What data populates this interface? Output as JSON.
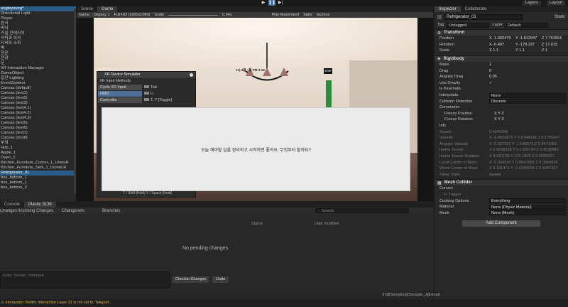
{
  "toolbar": {
    "play": "▶",
    "pause": "❚❚",
    "step": "▶|",
    "layers_label": "Layers",
    "layout_label": "Layout"
  },
  "hierarchy": {
    "items": [
      {
        "label": "angleyoung*",
        "selected": true
      },
      {
        "label": "Directional Light"
      },
      {
        "label": "Player"
      },
      {
        "label": "음식"
      },
      {
        "label": "바닥"
      },
      {
        "label": "거실 인테리어"
      },
      {
        "label": "식탁과 의자"
      },
      {
        "label": "티비와 소파"
      },
      {
        "label": "벽"
      },
      {
        "label": "창문"
      },
      {
        "label": "천장"
      },
      {
        "label": "문"
      },
      {
        "label": "XR Interaction Manager"
      },
      {
        "label": "GameObject"
      },
      {
        "label": "집안 Lighting"
      },
      {
        "label": "EventSystem"
      },
      {
        "label": "Canvas (default)"
      },
      {
        "label": "Canvas (text1)"
      },
      {
        "label": "Canvas (text2)"
      },
      {
        "label": "Canvas (text3)"
      },
      {
        "label": "Canvas (text4.1)"
      },
      {
        "label": "Canvas (text4.2)"
      },
      {
        "label": "Canvas (text4.3)"
      },
      {
        "label": "Canvas (text5)"
      },
      {
        "label": "Canvas (text6)"
      },
      {
        "label": "Canvas (text7)"
      },
      {
        "label": "Canvas (text8)"
      },
      {
        "label": "부엌"
      },
      {
        "label": "Hob_1"
      },
      {
        "label": "Apple_1"
      },
      {
        "label": "Oven_2"
      },
      {
        "label": "Kitchen_Furniture_Corner_1_UnionR"
      },
      {
        "label": "Kitchen_Furniture_Sink_1_UnionLR"
      },
      {
        "label": "Refrigerator_01",
        "highlight": true
      },
      {
        "label": "box_bottom_1"
      },
      {
        "label": "box_bottom_1"
      },
      {
        "label": "box_bottom_3"
      }
    ]
  },
  "game_view": {
    "tab_scene": "Scene",
    "tab_game": "Game",
    "mode": "Game",
    "display": "Display 1",
    "resolution": "Full HD (1920x1080)",
    "scale_label": "Scale",
    "scale_value": "0.54x",
    "play_maximized": "Play Maximized",
    "stats": "Stats",
    "gizmos": "Gizmos",
    "stop_sign": "STOP",
    "scene_text": "ex) 4월 ○일 PM 3:15",
    "dialog_text": "오늘 해야할 일을 정리하고 시작하면 좋아요. 무엇부터 할까요?"
  },
  "xr_simulator": {
    "title": "XR Device Simulator",
    "subtitle": "XR Input Methods",
    "rows": [
      {
        "button": "Cycle XR Input",
        "key": "Tab",
        "active": false
      },
      {
        "button": "HMD",
        "key": "U",
        "active": true
      },
      {
        "button": "Controller",
        "key": "T, Y [Toggle]",
        "active": false
      }
    ],
    "footer": "T / Shift [Hold]   Y / Space [Hold]"
  },
  "inspector": {
    "tab_inspector": "Inspector",
    "tab_collaborate": "Collaborate",
    "object_name": "Refrigerator_01",
    "static_label": "Static",
    "tag_label": "Tag",
    "tag_value": "Untagged",
    "layer_label": "Layer",
    "layer_value": "Default",
    "transform": {
      "title": "Transform",
      "position": {
        "label": "Position",
        "x": "X -1.602479",
        "y": "Y -1.812947",
        "z": "Z 7.761551"
      },
      "rotation": {
        "label": "Rotation",
        "x": "X -0.497",
        "y": "Y -178.337",
        "z": "Z 17.015"
      },
      "scale": {
        "label": "Scale",
        "x": "X 1.1",
        "y": "Y 1.1",
        "z": "Z 1"
      }
    },
    "rigidbody": {
      "title": "Rigidbody",
      "mass": {
        "label": "Mass",
        "value": "1"
      },
      "drag": {
        "label": "Drag",
        "value": "0"
      },
      "angular_drag": {
        "label": "Angular Drag",
        "value": "0.05"
      },
      "use_gravity": {
        "label": "Use Gravity",
        "value": "✓"
      },
      "is_kinematic": {
        "label": "Is Kinematic",
        "value": ""
      },
      "interpolate": {
        "label": "Interpolate",
        "value": "None"
      },
      "collision_detection": {
        "label": "Collision Detection",
        "value": "Discrete"
      },
      "constraints": "Constraints",
      "freeze_position": {
        "label": "Freeze Position",
        "value": "X  Y  Z"
      },
      "freeze_rotation": {
        "label": "Freeze Rotation",
        "value": "X  Y  Z"
      },
      "info": "Info",
      "speed": {
        "label": "Speed",
        "value": "0.4944396"
      },
      "velocity": {
        "label": "Velocity",
        "value": "X -0.4603875  Y 0.0344318  Z 0.1755247"
      },
      "angular_velocity": {
        "label": "Angular Velocity",
        "value": "X -0.237302  Y -1.635573  Z 0.8471055"
      },
      "inertia_tensor": {
        "label": "Inertia Tensor",
        "value": "X 0.4298398  Y 0.1300104  Z 0.3536889"
      },
      "inertia_tensor_rotation": {
        "label": "Inertia Tensor Rotation",
        "value": "X 4.510139  Y 315.1805  Z 0.0286557"
      },
      "local_center": {
        "label": "Local Center of Mass",
        "value": "X -0.034242  Y 0.9547659  Z 0.0864836"
      },
      "world_center": {
        "label": "World Center of Mass",
        "value": "X 3.101471  Y -0.0289554  Z 8.4947337"
      },
      "sleep_state": {
        "label": "Sleep State",
        "value": "Awake"
      }
    },
    "mesh_collider": {
      "title": "Mesh Collider",
      "convex": {
        "label": "Convex",
        "value": ""
      },
      "is_trigger": {
        "label": "Is Trigger",
        "value": ""
      },
      "cooking_options": {
        "label": "Cooking Options",
        "value": "Everything"
      },
      "material": {
        "label": "Material",
        "value": "None (Physic Material)"
      },
      "mesh": {
        "label": "Mesh",
        "value": "None (Mesh)"
      }
    },
    "add_component": "Add Component"
  },
  "bottom": {
    "tab_console": "Console",
    "tab_scm": "Plastic SCM",
    "scm_tabs": [
      "Pending Changes",
      "Incoming Changes",
      "Changesets",
      "Branches"
    ],
    "search_placeholder": "Search",
    "col_status": "Status",
    "col_date": "Date modified",
    "empty": "No pending changes",
    "comment_placeholder": "Enter checkin comment",
    "checkin_button": "Checkin Changes",
    "undo_button": "Undo",
    "user": "37@Socopie@Socopie_J@cloud"
  },
  "status_bar": {
    "message": "Interaction Toolkit: Interaction Layer 31 is not set to 'Teleport'."
  }
}
